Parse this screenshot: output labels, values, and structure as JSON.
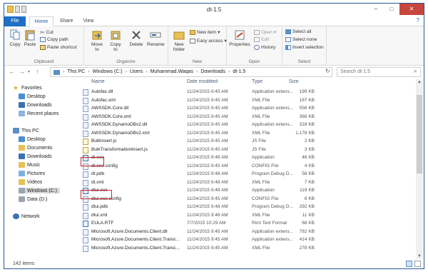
{
  "window": {
    "title": "dt-1.5"
  },
  "titlebar": {
    "minimize": "–",
    "maximize": "□",
    "close": "✕"
  },
  "ribbon_tabs": [
    "File",
    "Home",
    "Share",
    "View"
  ],
  "help_glyph": "?",
  "ribbon": {
    "clipboard": {
      "label": "Clipboard",
      "copy": "Copy",
      "paste": "Paste",
      "cut": "Cut",
      "copy_path": "Copy path",
      "paste_shortcut": "Paste shortcut"
    },
    "organize": {
      "label": "Organize",
      "move_to": "Move to",
      "copy_to": "Copy to",
      "delete": "Delete",
      "rename": "Rename"
    },
    "new": {
      "label": "New",
      "new_folder": "New folder",
      "new_item": "New item",
      "easy_access": "Easy access"
    },
    "open": {
      "label": "Open",
      "properties": "Properties",
      "open": "Open",
      "edit": "Edit",
      "history": "History"
    },
    "select": {
      "label": "Select",
      "select_all": "Select all",
      "select_none": "Select none",
      "invert_selection": "Invert selection"
    }
  },
  "address": {
    "crumbs": [
      "This PC",
      "Windows (C:)",
      "Users",
      "Muhammad.Waqas",
      "Downloads",
      "dt-1.5"
    ],
    "search_placeholder": "Search dt-1.5"
  },
  "nav_pane": {
    "favorites": "Favorites",
    "favorites_items": [
      "Desktop",
      "Downloads",
      "Recent places"
    ],
    "this_pc": "This PC",
    "this_pc_items": [
      "Desktop",
      "Documents",
      "Downloads",
      "Music",
      "Pictures",
      "Videos",
      "Windows (C:)",
      "Data (D:)"
    ],
    "network": "Network"
  },
  "columns": {
    "name": "Name",
    "date": "Date modified",
    "type": "Type",
    "size": "Size"
  },
  "files": [
    {
      "name": "Autofac.dll",
      "date": "11/24/2015 9:45 AM",
      "type": "Application extens...",
      "size": "199 KB",
      "kind": "dll"
    },
    {
      "name": "Autofac.xml",
      "date": "11/24/2015 9:45 AM",
      "type": "XML File",
      "size": "187 KB",
      "kind": "xml"
    },
    {
      "name": "AWSSDK.Core.dll",
      "date": "11/24/2015 9:45 AM",
      "type": "Application extens...",
      "size": "556 KB",
      "kind": "dll"
    },
    {
      "name": "AWSSDK.Core.xml",
      "date": "11/24/2015 9:45 AM",
      "type": "XML File",
      "size": "368 KB",
      "kind": "xml"
    },
    {
      "name": "AWSSDK.DynamoDBv2.dll",
      "date": "11/24/2015 9:45 AM",
      "type": "Application extens...",
      "size": "318 KB",
      "kind": "dll"
    },
    {
      "name": "AWSSDK.DynamoDBv2.xml",
      "date": "11/24/2015 9:45 AM",
      "type": "XML File",
      "size": "1,178 KB",
      "kind": "xml"
    },
    {
      "name": "BulkInsert.js",
      "date": "11/24/2015 9:45 AM",
      "type": "JS File",
      "size": "2 KB",
      "kind": "js"
    },
    {
      "name": "BulkTransformationInsert.js",
      "date": "11/24/2015 9:45 AM",
      "type": "JS File",
      "size": "3 KB",
      "kind": "js"
    },
    {
      "name": "dt.exe",
      "date": "11/24/2015 9:48 AM",
      "type": "Application",
      "size": "46 KB",
      "kind": "exe"
    },
    {
      "name": "dt.exe.config",
      "date": "11/24/2015 9:45 AM",
      "type": "CONFIG File",
      "size": "4 KB",
      "kind": "cfg"
    },
    {
      "name": "dt.pdb",
      "date": "11/24/2015 9:48 AM",
      "type": "Program Debug D...",
      "size": "58 KB",
      "kind": "pdb"
    },
    {
      "name": "dt.xml",
      "date": "11/24/2015 9:48 AM",
      "type": "XML File",
      "size": "7 KB",
      "kind": "xml"
    },
    {
      "name": "dtui.exe",
      "date": "11/24/2015 9:48 AM",
      "type": "Application",
      "size": "119 KB",
      "kind": "exe"
    },
    {
      "name": "dtui.exe.config",
      "date": "11/24/2015 9:45 AM",
      "type": "CONFIG File",
      "size": "6 KB",
      "kind": "cfg"
    },
    {
      "name": "dtui.pdb",
      "date": "11/24/2015 9:48 AM",
      "type": "Program Debug D...",
      "size": "292 KB",
      "kind": "pdb"
    },
    {
      "name": "dtui.xml",
      "date": "11/24/2015 9:48 AM",
      "type": "XML File",
      "size": "11 KB",
      "kind": "xml"
    },
    {
      "name": "EULA.RTF",
      "date": "7/7/2015 10:29 AM",
      "type": "Rich Text Format",
      "size": "68 KB",
      "kind": "rtf"
    },
    {
      "name": "Microsoft.Azure.Documents.Client.dll",
      "date": "11/24/2015 9:45 AM",
      "type": "Application extens...",
      "size": "782 KB",
      "kind": "dll"
    },
    {
      "name": "Microsoft.Azure.Documents.Client.Transi...",
      "date": "11/24/2015 9:45 AM",
      "type": "Application extens...",
      "size": "414 KB",
      "kind": "dll"
    },
    {
      "name": "Microsoft.Azure.Documents.Client.Transi...",
      "date": "11/24/2015 9:45 AM",
      "type": "XML File",
      "size": "278 KB",
      "kind": "xml"
    }
  ],
  "status": {
    "item_count": "142 items"
  }
}
